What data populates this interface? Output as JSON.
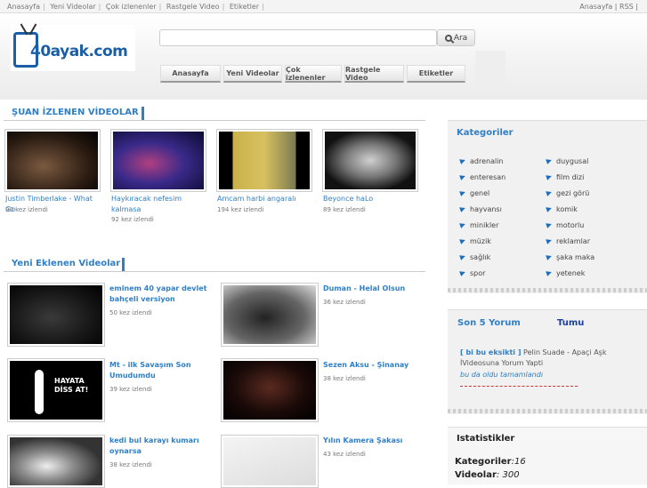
{
  "topbar": {
    "links": [
      "Anasayfa",
      "Yeni Videolar",
      "Çok izlenenler",
      "Rastgele Video",
      "Etiketler"
    ],
    "right": "Anasayfa | RSS |"
  },
  "logo": {
    "text": "40ayak.com"
  },
  "search": {
    "placeholder": "",
    "button": "Ara"
  },
  "nav": [
    "Anasayfa",
    "Yeni Videolar",
    "Çok izlenenler",
    "Rastgele Video",
    "Etiketler"
  ],
  "watching": {
    "title": "ŞUAN İZLENEN VİDEOLAR",
    "items": [
      {
        "title": "Justin Timberlake - What Go",
        "count": "90 kez izlendi"
      },
      {
        "title": "Haykıracak nefesim kalmasa",
        "count": "92 kez izlendi"
      },
      {
        "title": "Amcam harbi angaralı",
        "count": "194 kez izlendi"
      },
      {
        "title": "Beyonce haLo",
        "count": "89 kez izlendi"
      }
    ]
  },
  "recent": {
    "title": "Yeni Eklenen Videolar",
    "items": [
      {
        "title": "eminem 40 yapar devlet bahçeli versiyon",
        "count": "50 kez izlendi"
      },
      {
        "title": "Duman - Helal Olsun",
        "count": "36 kez izlendi"
      },
      {
        "title": "Mt - ilk Savaşım Son Umudumdu",
        "count": "39 kez izlendi",
        "thumb_text": "HAYATA DİSS AT!"
      },
      {
        "title": "Sezen Aksu - Şinanay",
        "count": "38 kez izlendi"
      },
      {
        "title": "kedi bul karayı kumarı oynarsa",
        "count": "38 kez izlendi"
      },
      {
        "title": "Yılın Kamera Şakası",
        "count": "43 kez izlendi"
      }
    ]
  },
  "sidebar": {
    "categories_title": "Kategoriler",
    "categories": [
      "adrenalin",
      "duygusal",
      "enteresan",
      "film dizi",
      "genel",
      "gezi görü",
      "hayvansı",
      "komik",
      "minikler",
      "motorlu",
      "müzik",
      "reklamlar",
      "sağlık",
      "şaka maka",
      "spor",
      "yetenek"
    ],
    "comments_title": "Son 5 Yorum",
    "comments_all": "Tumu",
    "comment": {
      "user": "[ bi bu eksikti ]",
      "text": "Pelin Suade - Apaçi Aşk İVideosuna Yorum Yapti",
      "quote": "bu da oldu tamamlandı"
    },
    "stats_title": "Istatistikler",
    "stats": [
      {
        "label": "Kategoriler",
        "value": ":16"
      },
      {
        "label": "Videolar",
        "value": ": 300"
      }
    ]
  },
  "colors": {
    "accent": "#2f7fc7",
    "logo": "#1a5ea8"
  }
}
